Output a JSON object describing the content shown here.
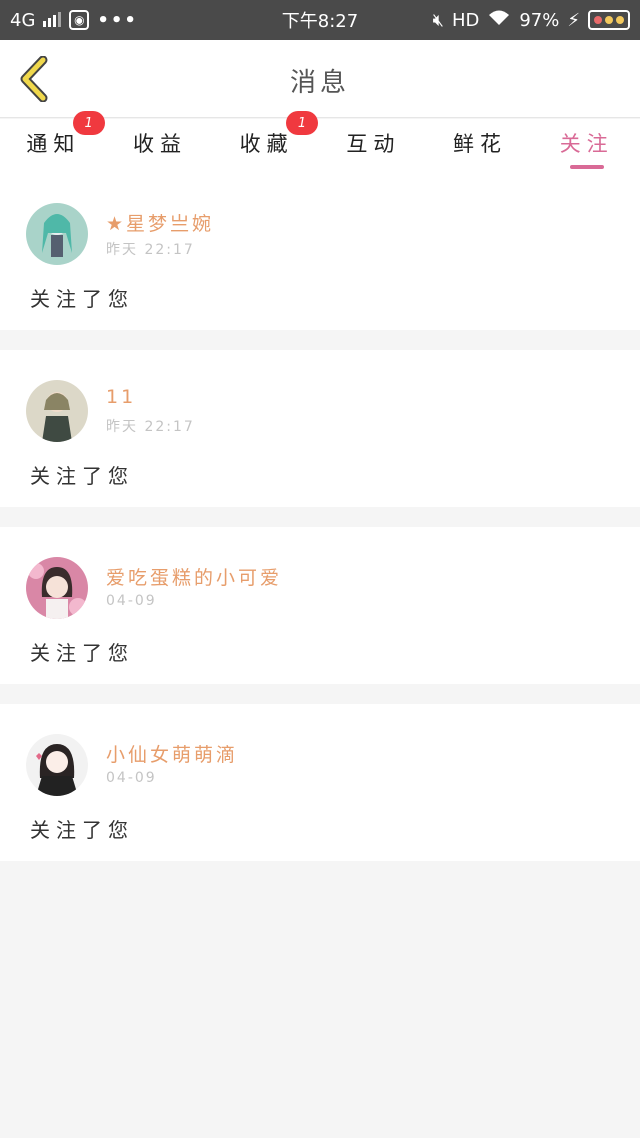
{
  "status_bar": {
    "network": "4G",
    "time": "下午8:27",
    "hd": "HD",
    "battery": "97%"
  },
  "header": {
    "title": "消息",
    "back_icon": "chevron-left-icon"
  },
  "colors": {
    "accent": "#d96a96",
    "username": "#e79d6b",
    "badge": "#f0393f",
    "back_icon": "#f0d84c"
  },
  "tabs": [
    {
      "label": "通知",
      "badge": "1",
      "active": false
    },
    {
      "label": "收益",
      "badge": null,
      "active": false
    },
    {
      "label": "收藏",
      "badge": "1",
      "active": false
    },
    {
      "label": "互动",
      "badge": null,
      "active": false
    },
    {
      "label": "鲜花",
      "badge": null,
      "active": false
    },
    {
      "label": "关注",
      "badge": null,
      "active": true
    }
  ],
  "messages": [
    {
      "username": "★星梦亗婉",
      "time": "昨天 22:17",
      "text": "关注了您"
    },
    {
      "username": "11",
      "time": "昨天 22:17",
      "text": "关注了您"
    },
    {
      "username": "爱吃蛋糕的小可爱",
      "time": "04-09",
      "text": "关注了您"
    },
    {
      "username": "小仙女萌萌滴",
      "time": "04-09",
      "text": "关注了您"
    }
  ]
}
